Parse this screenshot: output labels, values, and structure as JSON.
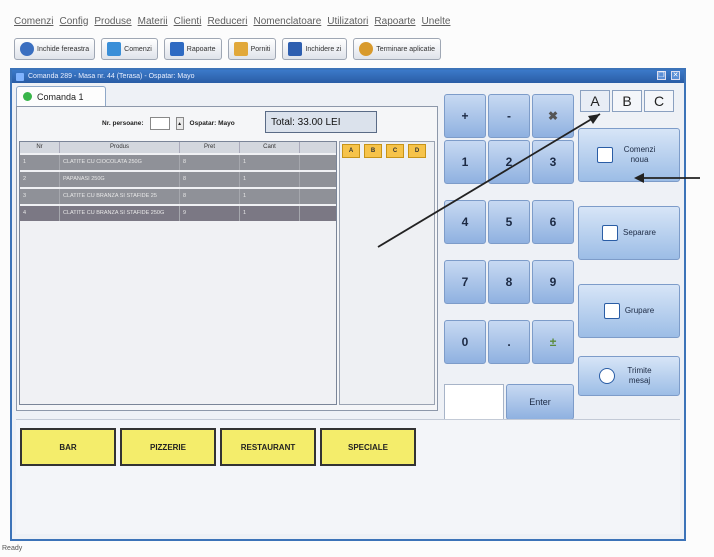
{
  "menu": [
    "Comenzi",
    "Config",
    "Produse",
    "Materii",
    "Clienti",
    "Reduceri",
    "Nomenclatoare",
    "Utilizatori",
    "Rapoarte",
    "Unelte"
  ],
  "toolbar": [
    {
      "label": "Inchide fereastra",
      "icon": "close-window-icon",
      "color": "#3a6fc0"
    },
    {
      "label": "Comenzi",
      "icon": "orders-icon",
      "color": "#3a8fd8"
    },
    {
      "label": "Rapoarte",
      "icon": "reports-icon",
      "color": "#2e6ac2"
    },
    {
      "label": "Porniti",
      "icon": "start-icon",
      "color": "#e1a83a"
    },
    {
      "label": "Inchidere zi",
      "icon": "close-day-icon",
      "color": "#2e5fb0"
    },
    {
      "label": "Terminare aplicatie",
      "icon": "exit-app-icon",
      "color": "#d89a2c"
    }
  ],
  "window": {
    "title": "Comanda 289 - Masa nr. 44 (Terasa) - Ospatar: Mayo",
    "controls": [
      "restore",
      "close"
    ]
  },
  "tab": {
    "label": "Comanda 1"
  },
  "order": {
    "persons_label": "Nr. persoane:",
    "waiter_label": "Ospatar: Mayo",
    "total": "Total: 33.00 LEI",
    "columns": [
      "Nr",
      "Produs",
      "Pret",
      "Cant"
    ],
    "rows": [
      [
        "1",
        "CLATITE CU CIOCOLATA 250G",
        "8",
        "1"
      ],
      [
        "2",
        "PAPANASI 250G",
        "8",
        "1"
      ],
      [
        "3",
        "CLATITE CU BRANZA SI STAFIDE 25",
        "8",
        "1"
      ],
      [
        "4",
        "CLATITE CU BRANZA SI STAFIDE 250G",
        "9",
        "1"
      ]
    ]
  },
  "abcd": [
    "A",
    "B",
    "C",
    "D"
  ],
  "keypad": {
    "keys": [
      "+",
      "-",
      "✖",
      "1",
      "2",
      "3",
      "4",
      "5",
      "6",
      "7",
      "8",
      "9",
      "0",
      ".",
      "±"
    ],
    "enter": "Enter"
  },
  "abc_tabs": [
    "A",
    "B",
    "C"
  ],
  "actions": [
    "Comenzi noua",
    "Separare",
    "Grupare",
    "Trimite mesaj"
  ],
  "categories": [
    "BAR",
    "PIZZERIE",
    "RESTAURANT",
    "SPECIALE"
  ],
  "status": "Ready",
  "colors": {
    "accent": "#3c73b8",
    "category_yellow": "#f4ed6b",
    "abcd_orange": "#f6c34a"
  }
}
